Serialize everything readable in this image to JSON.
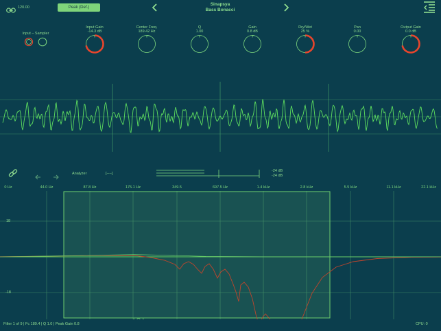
{
  "header": {
    "tempo": "120.00",
    "preset_button": "Peak (Def.)",
    "instrument": "Sinapsya",
    "preset_name": "Bass Bonacci"
  },
  "input": {
    "label": "Input – Sampler"
  },
  "knobs": [
    {
      "label": "Input Gain",
      "value": "-14.3 dB",
      "level": 0.72,
      "active": true
    },
    {
      "label": "Center Freq.",
      "value": "189.42 Hz",
      "level": 0.08,
      "active": false
    },
    {
      "label": "Q",
      "value": "1.00",
      "level": 0.0,
      "active": false
    },
    {
      "label": "Gain",
      "value": "0.8 dB",
      "level": 0.03,
      "active": false
    },
    {
      "label": "Dry/Wet",
      "value": "25 %",
      "level": 0.5,
      "active": true
    },
    {
      "label": "Pan",
      "value": "0.00",
      "level": 0.0,
      "active": false
    },
    {
      "label": "Output Gain",
      "value": "0.0 dB",
      "level": 0.72,
      "active": true
    }
  ],
  "toolbar": {
    "analyzer_label": "Analyzer",
    "bracket_label": "[----]",
    "meter_top": "-24 dB",
    "meter_bottom": "-24 dB"
  },
  "frequency_axis": [
    "0 Hz",
    "44.0 Hz",
    "87.8 Hz",
    "175.1 Hz",
    "349.5",
    "697.5 Hz",
    "1.4 kHz",
    "2.8 kHz",
    "5.5 kHz",
    "11.1 kHz",
    "22.1 kHz"
  ],
  "gain_axis": [
    "18",
    "-18"
  ],
  "status": {
    "filter_info": "Filter 1 of 9 | Fc 189.4 | Q 1.0 | Peak Gain 0.8",
    "cpu": "CPU: 0"
  },
  "colors": {
    "background": "#0b3e4d",
    "accent_green": "#7fd97f",
    "knob_red": "#e8452c",
    "filter_red": "#c0452c"
  }
}
